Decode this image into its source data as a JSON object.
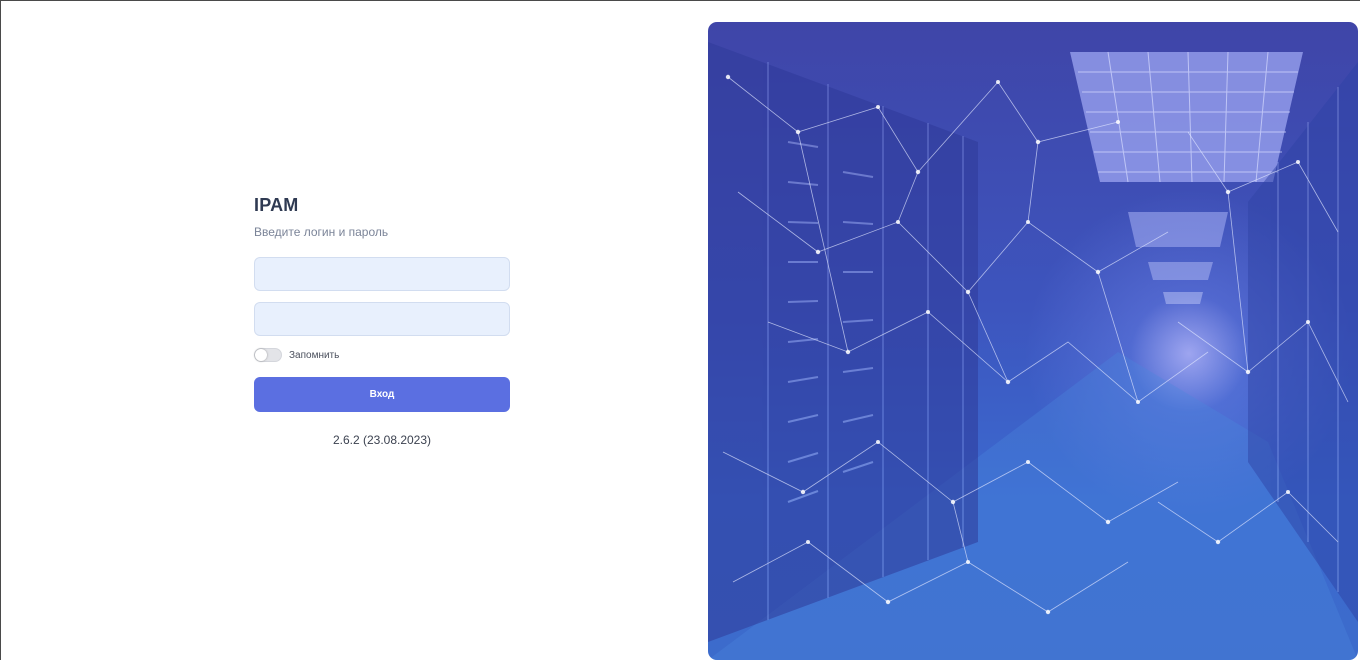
{
  "app": {
    "title": "IPAM",
    "subtitle": "Введите логин и пароль"
  },
  "form": {
    "login_value": "",
    "password_value": "",
    "remember_label": "Запомнить",
    "remember_checked": false,
    "submit_label": "Вход"
  },
  "footer": {
    "version": "2.6.2 (23.08.2023)"
  },
  "colors": {
    "accent": "#5b6fe1",
    "field_bg": "#e8f0fd",
    "title": "#2f3a52",
    "hero_top": "#3f45a8",
    "hero_bottom": "#3c6bcb"
  },
  "hero": {
    "image_description_icon": "server-datacenter-illustration"
  }
}
